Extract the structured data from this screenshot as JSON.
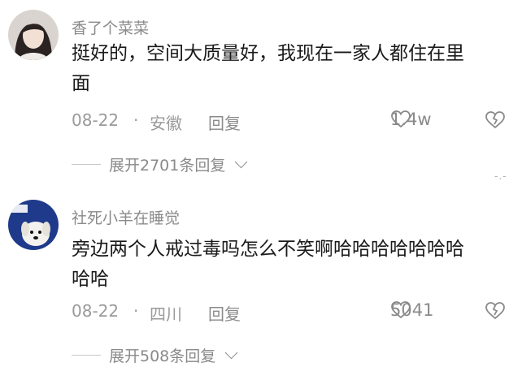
{
  "comments": [
    {
      "username": "香了个菜菜",
      "text_line1": "挺好的，空间大质量好，我现在一家人都住在里",
      "text_line2": "面",
      "date": "08-22",
      "separator": "·",
      "location": "安徽",
      "reply_label": "回复",
      "likes": "1.4w",
      "expand_label": "展开2701条回复",
      "avatar_icon": "avatar-girl-photo"
    },
    {
      "username": "社死小羊在睡觉",
      "text_line1": "旁边两个人戒过毒吗怎么不笑啊哈哈哈哈哈哈哈",
      "text_line2": "哈哈",
      "date": "08-22",
      "separator": "·",
      "location": "四川",
      "reply_label": "回复",
      "likes": "5041",
      "expand_label": "展开508条回复",
      "avatar_icon": "avatar-dog-photo"
    }
  ],
  "colors": {
    "meta": "#9a9a9a",
    "text": "#1a1a1a",
    "username": "#8a8a8a"
  }
}
